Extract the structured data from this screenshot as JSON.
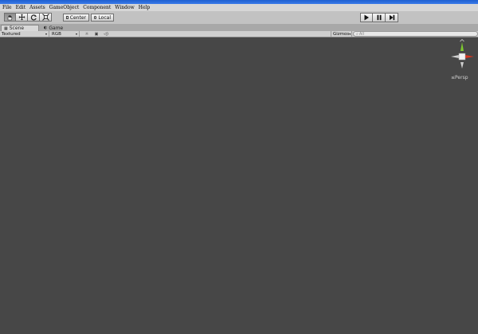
{
  "menubar": {
    "items": [
      "File",
      "Edit",
      "Assets",
      "GameObject",
      "Component",
      "Window",
      "Help"
    ]
  },
  "toolbar": {
    "tools": [
      "hand-tool",
      "move-tool",
      "rotate-tool",
      "scale-tool"
    ],
    "pivot_label": "Center",
    "space_label": "Local",
    "playback": [
      "play",
      "pause",
      "step"
    ]
  },
  "tabs": [
    {
      "label": "Scene",
      "active": true
    },
    {
      "label": "Game",
      "active": false
    }
  ],
  "scene_options": {
    "render_mode": "Textured",
    "color_mode": "RGB",
    "gizmos_label": "Gizmos",
    "search_placeholder": "All"
  },
  "viewport": {
    "projection_label": "Persp",
    "background": "#474747"
  },
  "colors": {
    "title_blue": "#2a6ad8",
    "gizmo_red": "#d8361f",
    "gizmo_green": "#7ec92f"
  }
}
